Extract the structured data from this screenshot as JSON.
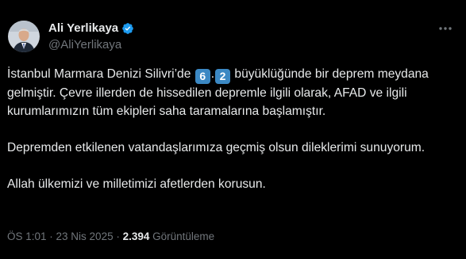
{
  "author": {
    "name": "Ali Yerlikaya",
    "handle": "@AliYerlikaya",
    "verified_badge_icon": "verified-badge-icon",
    "verified_color": "#1d9bf0"
  },
  "more_icon": "more-horizontal-icon",
  "post": {
    "para1_before": "İstanbul Marmara Denizi Silivri’de ",
    "magnitude_digit1": "6",
    "magnitude_dot": ".",
    "magnitude_digit2": "2",
    "para1_after": " büyüklüğünde bir deprem meydana gelmiştir. Çevre illerden de hissedilen depremle ilgili olarak, AFAD ve ilgili kurumlarımızın tüm ekipleri saha taramalarına başlamıştır.",
    "para2": "Depremden etkilenen vatandaşlarımıza geçmiş olsun dileklerimi sunuyorum.",
    "para3": "Allah ülkemizi ve milletimizi afetlerden korusun."
  },
  "meta": {
    "time": "ÖS 1:01",
    "separator": " · ",
    "date": "23 Nis 2025",
    "views_count": "2.394",
    "views_label": " Görüntüleme"
  },
  "colors": {
    "background": "#000000",
    "text": "#e7e9ea",
    "secondary_text": "#71767b",
    "keycap_blue": "#3b88c3"
  }
}
